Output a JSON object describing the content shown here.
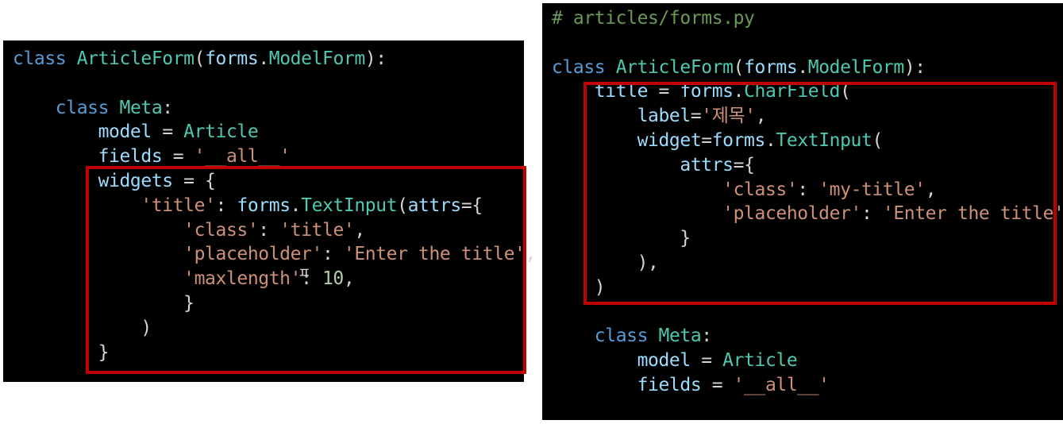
{
  "left_panel": {
    "lines": [
      [
        [
          "kw",
          "class"
        ],
        [
          "op",
          " "
        ],
        [
          "cls",
          "ArticleForm"
        ],
        [
          "op",
          "("
        ],
        [
          "id",
          "forms"
        ],
        [
          "op",
          "."
        ],
        [
          "cls",
          "ModelForm"
        ],
        [
          "op",
          "):"
        ]
      ],
      [],
      [
        [
          "op",
          "    "
        ],
        [
          "kw",
          "class"
        ],
        [
          "op",
          " "
        ],
        [
          "cls",
          "Meta"
        ],
        [
          "op",
          ":"
        ]
      ],
      [
        [
          "op",
          "        "
        ],
        [
          "id",
          "model"
        ],
        [
          "op",
          " = "
        ],
        [
          "cls",
          "Article"
        ]
      ],
      [
        [
          "op",
          "        "
        ],
        [
          "id",
          "fields"
        ],
        [
          "op",
          " = "
        ],
        [
          "str",
          "'__all__'"
        ]
      ],
      [
        [
          "op",
          "        "
        ],
        [
          "id",
          "widgets"
        ],
        [
          "op",
          " = {"
        ]
      ],
      [
        [
          "op",
          "            "
        ],
        [
          "str",
          "'title'"
        ],
        [
          "op",
          ": "
        ],
        [
          "id",
          "forms"
        ],
        [
          "op",
          "."
        ],
        [
          "cls",
          "TextInput"
        ],
        [
          "op",
          "("
        ],
        [
          "id",
          "attrs"
        ],
        [
          "op",
          "={"
        ]
      ],
      [
        [
          "op",
          "                "
        ],
        [
          "str",
          "'class'"
        ],
        [
          "op",
          ": "
        ],
        [
          "str",
          "'title'"
        ],
        [
          "op",
          ","
        ]
      ],
      [
        [
          "op",
          "                "
        ],
        [
          "str",
          "'placeholder'"
        ],
        [
          "op",
          ": "
        ],
        [
          "str",
          "'Enter the title'"
        ],
        [
          "op",
          ","
        ]
      ],
      [
        [
          "op",
          "                "
        ],
        [
          "str",
          "'maxlength'"
        ],
        [
          "op",
          ": "
        ],
        [
          "num",
          "10"
        ],
        [
          "op",
          ","
        ]
      ],
      [
        [
          "op",
          "                }"
        ]
      ],
      [
        [
          "op",
          "            )"
        ]
      ],
      [
        [
          "op",
          "        }"
        ]
      ]
    ],
    "ime_cursor": "ㅍ"
  },
  "right_panel": {
    "lines": [
      [
        [
          "cmt",
          "# articles/forms.py"
        ]
      ],
      [],
      [
        [
          "kw",
          "class"
        ],
        [
          "op",
          " "
        ],
        [
          "cls",
          "ArticleForm"
        ],
        [
          "op",
          "("
        ],
        [
          "id",
          "forms"
        ],
        [
          "op",
          "."
        ],
        [
          "cls",
          "ModelForm"
        ],
        [
          "op",
          "):"
        ]
      ],
      [
        [
          "op",
          "    "
        ],
        [
          "id",
          "title"
        ],
        [
          "op",
          " = "
        ],
        [
          "id",
          "forms"
        ],
        [
          "op",
          "."
        ],
        [
          "cls",
          "CharField"
        ],
        [
          "op",
          "("
        ]
      ],
      [
        [
          "op",
          "        "
        ],
        [
          "id",
          "label"
        ],
        [
          "op",
          "="
        ],
        [
          "str",
          "'제목'"
        ],
        [
          "op",
          ","
        ]
      ],
      [
        [
          "op",
          "        "
        ],
        [
          "id",
          "widget"
        ],
        [
          "op",
          "="
        ],
        [
          "id",
          "forms"
        ],
        [
          "op",
          "."
        ],
        [
          "cls",
          "TextInput"
        ],
        [
          "op",
          "("
        ]
      ],
      [
        [
          "op",
          "            "
        ],
        [
          "id",
          "attrs"
        ],
        [
          "op",
          "={"
        ]
      ],
      [
        [
          "op",
          "                "
        ],
        [
          "str",
          "'class'"
        ],
        [
          "op",
          ": "
        ],
        [
          "str",
          "'my-title'"
        ],
        [
          "op",
          ","
        ]
      ],
      [
        [
          "op",
          "                "
        ],
        [
          "str",
          "'placeholder'"
        ],
        [
          "op",
          ": "
        ],
        [
          "str",
          "'Enter the title'"
        ],
        [
          "op",
          ","
        ]
      ],
      [
        [
          "op",
          "            }"
        ]
      ],
      [
        [
          "op",
          "        ),"
        ]
      ],
      [
        [
          "op",
          "    )"
        ]
      ],
      [],
      [
        [
          "op",
          "    "
        ],
        [
          "kw",
          "class"
        ],
        [
          "op",
          " "
        ],
        [
          "cls",
          "Meta"
        ],
        [
          "op",
          ":"
        ]
      ],
      [
        [
          "op",
          "        "
        ],
        [
          "id",
          "model"
        ],
        [
          "op",
          " = "
        ],
        [
          "cls",
          "Article"
        ]
      ],
      [
        [
          "op",
          "        "
        ],
        [
          "id",
          "fields"
        ],
        [
          "op",
          " = "
        ],
        [
          "str",
          "'__all__'"
        ]
      ]
    ]
  },
  "colors": {
    "background": "#000000",
    "keyword": "#569cd6",
    "class_name": "#4ec9b0",
    "identifier": "#9cdcfe",
    "operator": "#d4d4d4",
    "string": "#ce9178",
    "number": "#b5cea8",
    "comment": "#6a9955",
    "highlight_border": "#c00000"
  }
}
